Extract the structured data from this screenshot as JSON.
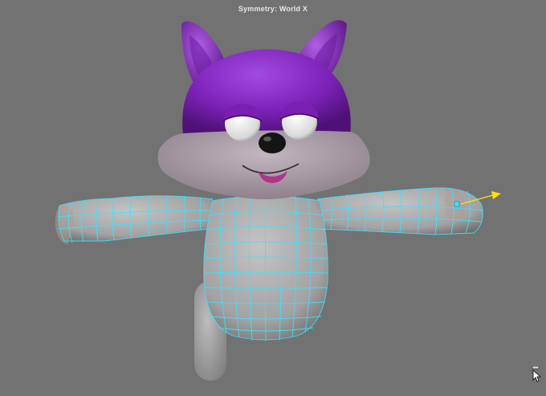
{
  "viewport": {
    "hud_title": "Symmetry: World X"
  },
  "scene": {
    "model": "cartoon-fox-character",
    "selection_mode": "symmetry-world-x",
    "colors": {
      "background": "#727272",
      "fur_purple": "#8a2fc4",
      "muzzle_gray": "#a89aa6",
      "body_gray": "#a6a6a6",
      "wireframe": "#3fe0ff",
      "manipulator_arrow": "#ffe000"
    }
  },
  "icons": {
    "cursor": "mouse-cursor-icon",
    "move_arrow": "move-manipulator-arrow-icon"
  }
}
